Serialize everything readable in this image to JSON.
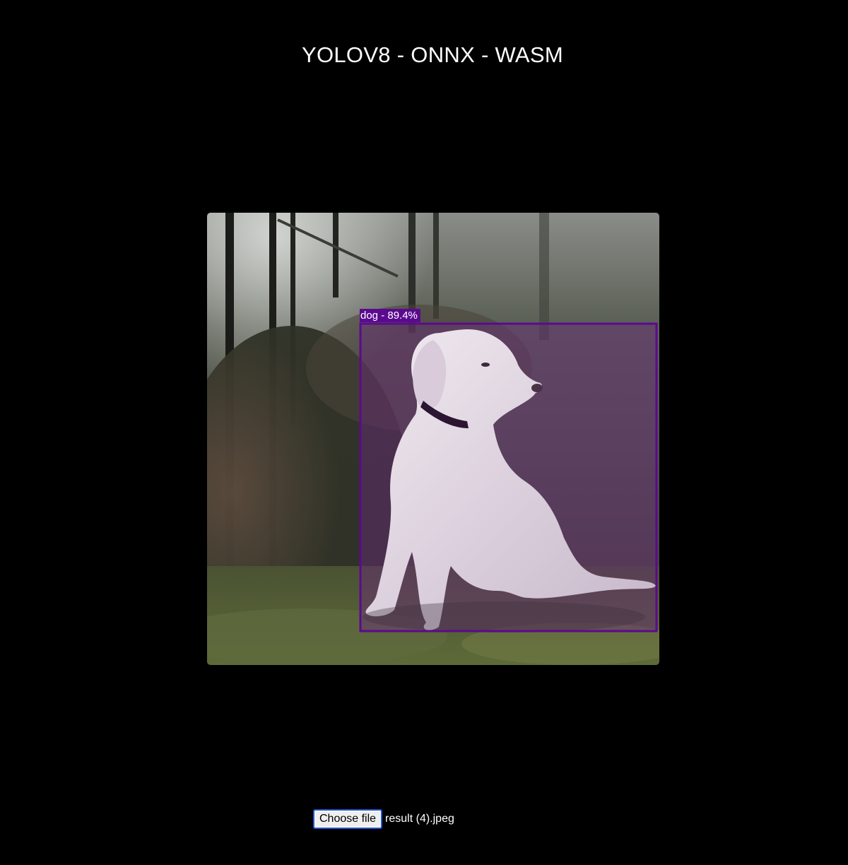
{
  "page": {
    "title": "YOLOV8 - ONNX - WASM",
    "background": "#000000"
  },
  "viewer": {
    "image_description_icon": "photo-dog-sitting",
    "detections": [
      {
        "label": "dog - 89.4%",
        "class": "dog",
        "confidence_percent": 89.4,
        "box_color": "#5b0a8f"
      }
    ]
  },
  "file_input": {
    "button_label": "Choose file",
    "file_name": "result (4).jpeg",
    "focus_color": "#1f55d6"
  }
}
